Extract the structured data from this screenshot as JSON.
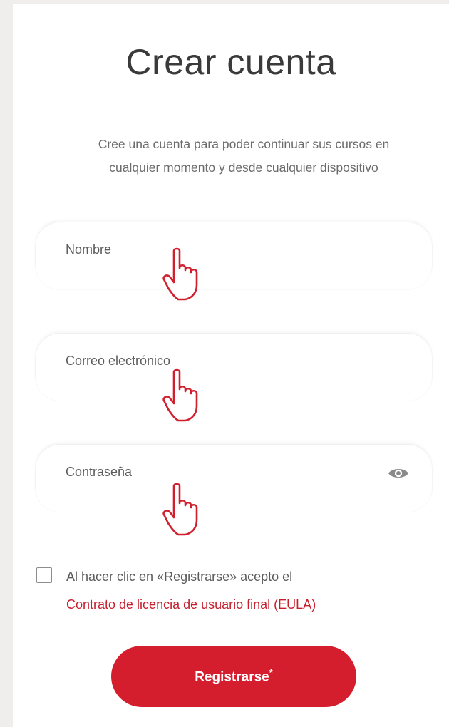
{
  "title": "Crear cuenta",
  "subtitle_line1": "Cree una cuenta para poder continuar sus cursos en",
  "subtitle_line2": "cualquier momento y desde cualquier dispositivo",
  "fields": {
    "name": {
      "placeholder": "Nombre",
      "value": ""
    },
    "email": {
      "placeholder": "Correo electrónico",
      "value": ""
    },
    "password": {
      "placeholder": "Contraseña",
      "value": "",
      "toggle_icon": "eye-icon"
    }
  },
  "agreement": {
    "text": "Al hacer clic en «Registrarse» acepto el",
    "link_label": "Contrato de licencia de usuario final (EULA)",
    "checked": false
  },
  "submit": {
    "label": "Registrarse",
    "mark": "*"
  },
  "pointer_icon": "hand-pointer-icon",
  "colors": {
    "accent": "#d41e2e",
    "link": "#c71e2c",
    "pointer": "#d0202e",
    "background": "#efeeec"
  }
}
